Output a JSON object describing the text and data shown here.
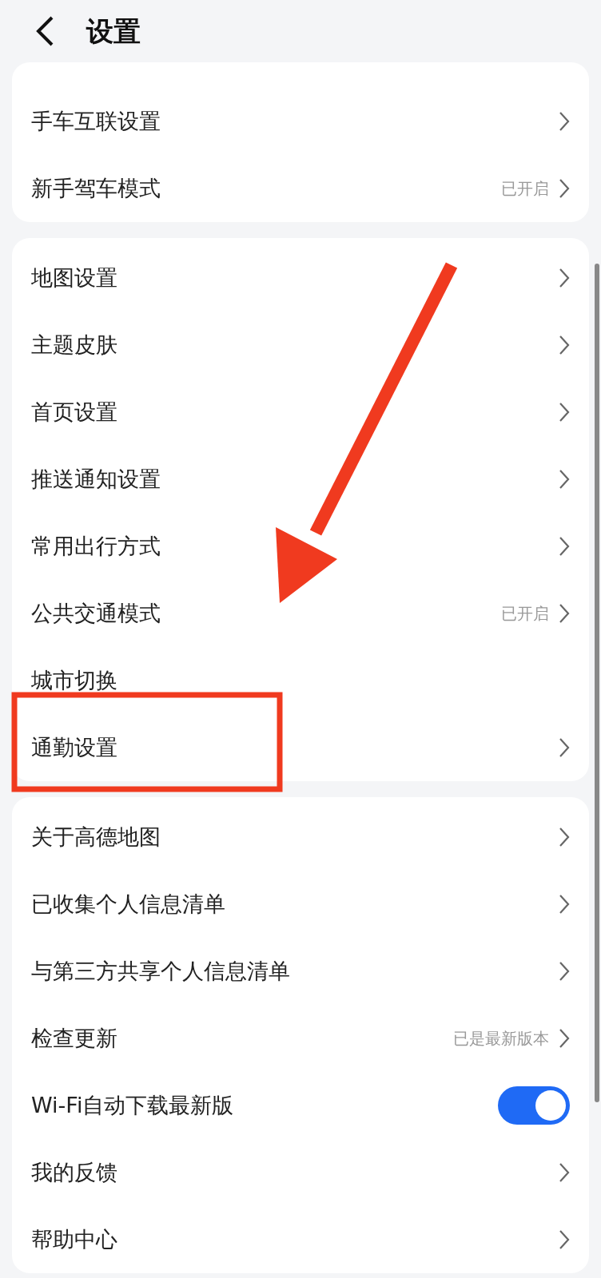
{
  "header": {
    "title": "设置"
  },
  "sections": [
    {
      "items": [
        {
          "kind": "link",
          "label": "手车互联设置"
        },
        {
          "kind": "link",
          "label": "新手驾车模式",
          "value": "已开启"
        }
      ]
    },
    {
      "items": [
        {
          "kind": "link",
          "label": "地图设置"
        },
        {
          "kind": "link",
          "label": "主题皮肤"
        },
        {
          "kind": "link",
          "label": "首页设置"
        },
        {
          "kind": "link",
          "label": "推送通知设置"
        },
        {
          "kind": "link",
          "label": "常用出行方式"
        },
        {
          "kind": "link",
          "label": "公共交通模式",
          "value": "已开启"
        },
        {
          "kind": "plain",
          "label": "城市切换"
        },
        {
          "kind": "link",
          "label": "通勤设置"
        }
      ]
    },
    {
      "items": [
        {
          "kind": "link",
          "label": "关于高德地图"
        },
        {
          "kind": "link",
          "label": "已收集个人信息清单"
        },
        {
          "kind": "link",
          "label": "与第三方共享个人信息清单"
        },
        {
          "kind": "link",
          "label": "检查更新",
          "value": "已是最新版本"
        },
        {
          "kind": "toggle",
          "label": "Wi-Fi自动下载最新版",
          "on": true
        },
        {
          "kind": "link",
          "label": "我的反馈"
        },
        {
          "kind": "link",
          "label": "帮助中心"
        }
      ]
    }
  ]
}
